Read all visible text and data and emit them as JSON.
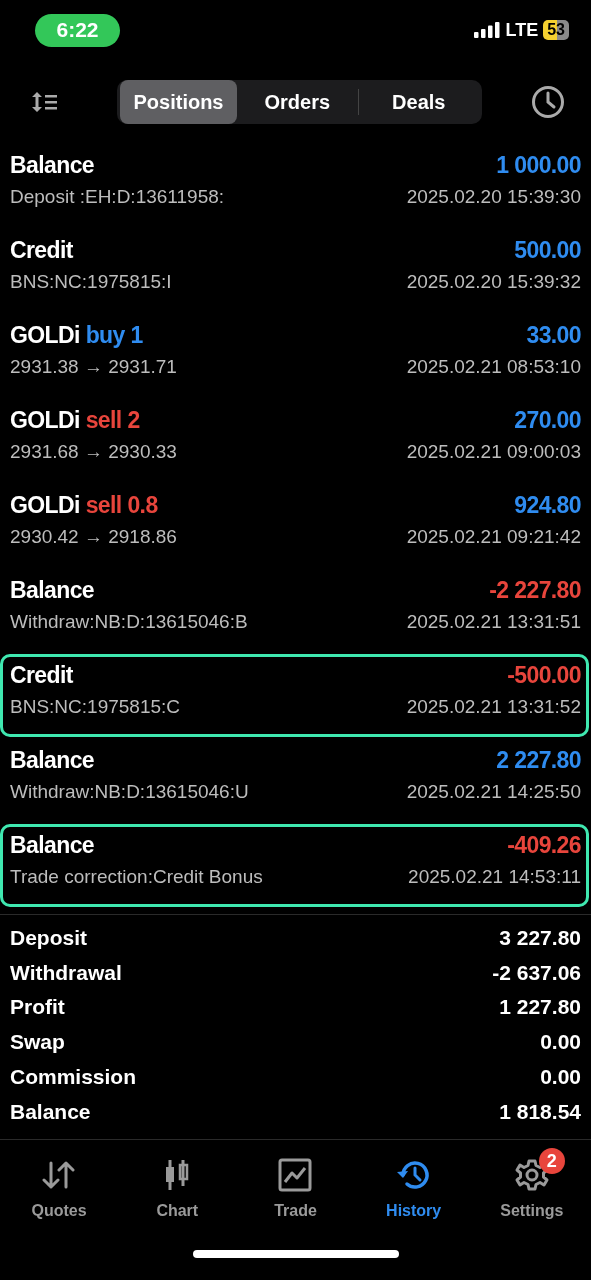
{
  "status_bar": {
    "time": "6:22",
    "network": "LTE",
    "battery": "53"
  },
  "tabs": [
    {
      "label": "Positions",
      "selected": true
    },
    {
      "label": "Orders",
      "selected": false
    },
    {
      "label": "Deals",
      "selected": false
    }
  ],
  "rows": [
    {
      "title": "Balance",
      "amount": "1 000.00",
      "color": "#2f8cf0",
      "comment": "Deposit :EH:D:13611958:",
      "time": "2025.02.20 15:39:30",
      "highlighted": false
    },
    {
      "title": "Credit",
      "amount": "500.00",
      "color": "#2f8cf0",
      "comment": "BNS:NC:1975815:I",
      "time": "2025.02.20 15:39:32",
      "highlighted": false
    },
    {
      "title": "GOLDi",
      "side": {
        "kind": "buy",
        "text": "buy 1"
      },
      "amount": "33.00",
      "color": "#2f8cf0",
      "comment": "2931.38 → 2931.71",
      "time": "2025.02.21 08:53:10",
      "highlighted": false
    },
    {
      "title": "GOLDi",
      "side": {
        "kind": "sell",
        "text": "sell 2"
      },
      "amount": "270.00",
      "color": "#2f8cf0",
      "comment": "2931.68 → 2930.33",
      "time": "2025.02.21 09:00:03",
      "highlighted": false
    },
    {
      "title": "GOLDi",
      "side": {
        "kind": "sell",
        "text": "sell 0.8"
      },
      "amount": "924.80",
      "color": "#2f8cf0",
      "comment": "2930.42 → 2918.86",
      "time": "2025.02.21 09:21:42",
      "highlighted": false
    },
    {
      "title": "Balance",
      "amount": "-2 227.80",
      "color": "#e8453c",
      "comment": "Withdraw:NB:D:13615046:B",
      "time": "2025.02.21 13:31:51",
      "highlighted": false
    },
    {
      "title": "Credit",
      "amount": "-500.00",
      "color": "#e8453c",
      "comment": "BNS:NC:1975815:C",
      "time": "2025.02.21 13:31:52",
      "highlighted": true
    },
    {
      "title": "Balance",
      "amount": "2 227.80",
      "color": "#2f8cf0",
      "comment": "Withdraw:NB:D:13615046:U",
      "time": "2025.02.21 14:25:50",
      "highlighted": false
    },
    {
      "title": "Balance",
      "amount": "-409.26",
      "color": "#e8453c",
      "comment": "Trade correction:Credit Bonus",
      "time": "2025.02.21 14:53:11",
      "highlighted": true
    }
  ],
  "summary": [
    {
      "label": "Deposit",
      "value": "3 227.80"
    },
    {
      "label": "Withdrawal",
      "value": "-2 637.06"
    },
    {
      "label": "Profit",
      "value": "1 227.80"
    },
    {
      "label": "Swap",
      "value": "0.00"
    },
    {
      "label": "Commission",
      "value": "0.00"
    },
    {
      "label": "Balance",
      "value": "1 818.54"
    }
  ],
  "nav": [
    {
      "kind": "quotes",
      "label": "Quotes",
      "selected": false
    },
    {
      "kind": "chart",
      "label": "Chart",
      "selected": false
    },
    {
      "kind": "trade",
      "label": "Trade",
      "selected": false
    },
    {
      "kind": "history",
      "label": "History",
      "selected": true
    },
    {
      "kind": "settings",
      "label": "Settings",
      "selected": false,
      "badge": "2"
    }
  ]
}
